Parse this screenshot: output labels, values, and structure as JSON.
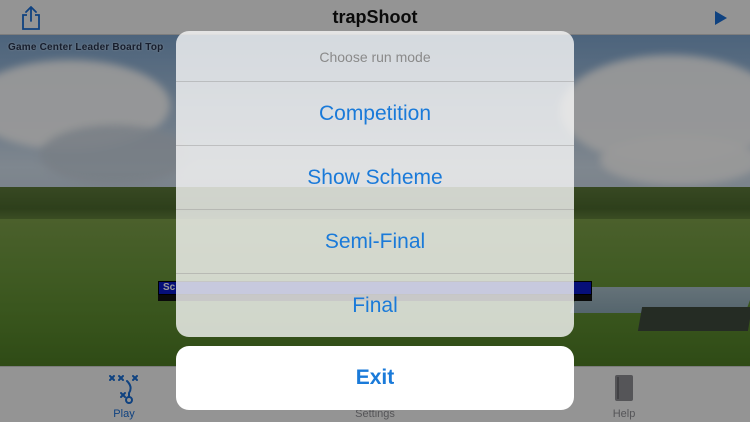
{
  "app": {
    "title": "trapShoot"
  },
  "scene": {
    "leaderboard_title": "Game Center Leader Board Top",
    "score_label": "Sc"
  },
  "tabs": [
    {
      "label": "Play",
      "icon": "play-scheme-icon",
      "active": true
    },
    {
      "label": "Settings",
      "icon": "gear-icon",
      "active": false
    },
    {
      "label": "Help",
      "icon": "book-icon",
      "active": false
    }
  ],
  "action_sheet": {
    "title": "Choose run mode",
    "options": [
      "Competition",
      "Show Scheme",
      "Semi-Final",
      "Final"
    ],
    "cancel_label": "Exit"
  },
  "colors": {
    "accent": "#1a7ad9",
    "score_bar": "#0b19c9"
  }
}
